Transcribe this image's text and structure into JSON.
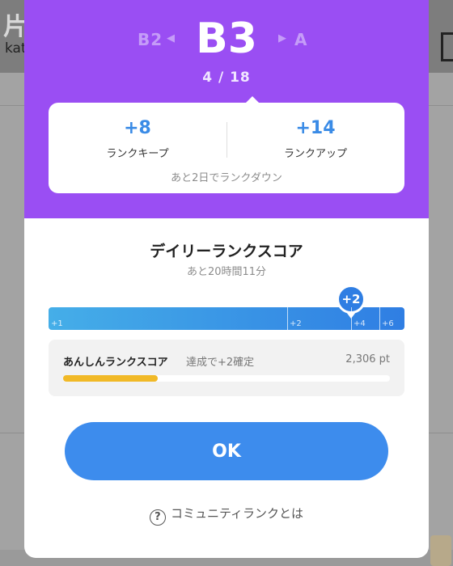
{
  "background": {
    "glyph": "片",
    "username_fragment": "kat"
  },
  "rank": {
    "previous": "B2",
    "current": "B3",
    "next": "A",
    "position": "4 / 18"
  },
  "score_card": {
    "keep_value": "+8",
    "keep_label": "ランクキープ",
    "up_value": "+14",
    "up_label": "ランクアップ",
    "down_note": "あと2日でランクダウン"
  },
  "daily": {
    "title": "デイリーランクスコア",
    "remaining": "あと20時間11分",
    "marker_label": "+2",
    "marker_position": 0.85,
    "ticks": [
      {
        "label": "+1",
        "position": 0.0
      },
      {
        "label": "+2",
        "position": 0.67
      },
      {
        "label": "+4",
        "position": 0.85
      },
      {
        "label": "+6",
        "position": 0.93
      }
    ]
  },
  "safe_score": {
    "title": "あんしんランクスコア",
    "subtitle": "達成で+2確定",
    "points": "2,306 pt",
    "progress": 0.29
  },
  "buttons": {
    "ok_label": "OK",
    "help_label": "コミュニティランクとは"
  },
  "colors": {
    "header": "#9a4ef3",
    "accent_blue": "#3d8ced",
    "progress_yellow": "#f1b927"
  }
}
